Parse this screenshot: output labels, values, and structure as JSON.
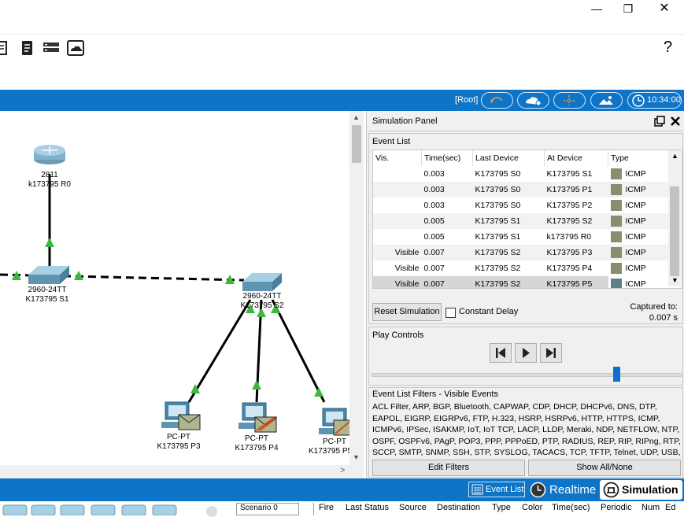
{
  "window": {
    "minimize": "—",
    "restore": "❐",
    "close": "✕"
  },
  "toolbar": {
    "help_label": "?"
  },
  "bluebar": {
    "root_label": "[Root]",
    "clock": "10:34:00"
  },
  "workspace": {
    "devices": [
      {
        "model": "2811",
        "name": "k173795 R0"
      },
      {
        "model": "2960-24TT",
        "name": "K173795 S1"
      },
      {
        "model": "2960-24TT",
        "name": "K173795 S2"
      },
      {
        "model": "PC-PT",
        "name": "K173795 P3"
      },
      {
        "model": "PC-PT",
        "name": "K173795 P4"
      },
      {
        "model": "PC-PT",
        "name": "K173795 P5"
      }
    ]
  },
  "simulation_panel": {
    "title": "Simulation Panel",
    "event_list_label": "Event List",
    "columns": [
      "Vis.",
      "Time(sec)",
      "Last Device",
      "At Device",
      "Type"
    ],
    "events": [
      {
        "vis": "",
        "time": "0.003",
        "last": "K173795 S0",
        "at": "K173795 S1",
        "type": "ICMP",
        "color": "#8c8c6e"
      },
      {
        "vis": "",
        "time": "0.003",
        "last": "K173795 S0",
        "at": "K173795 P1",
        "type": "ICMP",
        "color": "#8c8c6e"
      },
      {
        "vis": "",
        "time": "0.003",
        "last": "K173795 S0",
        "at": "K173795 P2",
        "type": "ICMP",
        "color": "#8c8c6e"
      },
      {
        "vis": "",
        "time": "0.005",
        "last": "K173795 S1",
        "at": "K173795 S2",
        "type": "ICMP",
        "color": "#8c8c6e"
      },
      {
        "vis": "",
        "time": "0.005",
        "last": "K173795 S1",
        "at": "k173795 R0",
        "type": "ICMP",
        "color": "#8c8c6e"
      },
      {
        "vis": "Visible",
        "time": "0.007",
        "last": "K173795 S2",
        "at": "K173795 P3",
        "type": "ICMP",
        "color": "#8c8c6e"
      },
      {
        "vis": "Visible",
        "time": "0.007",
        "last": "K173795 S2",
        "at": "K173795 P4",
        "type": "ICMP",
        "color": "#8c8c6e"
      },
      {
        "vis": "Visible",
        "time": "0.007",
        "last": "K173795 S2",
        "at": "K173795 P5",
        "type": "ICMP",
        "color": "#5f7f86"
      }
    ],
    "reset_button": "Reset Simulation",
    "constant_delay": "Constant Delay",
    "captured_label": "Captured to:",
    "captured_value": "0.007 s",
    "play_controls_label": "Play Controls",
    "filters_title": "Event List Filters - Visible Events",
    "filters_text": "ACL Filter, ARP, BGP, Bluetooth, CAPWAP, CDP, DHCP, DHCPv6, DNS, DTP, EAPOL, EIGRP, EIGRPv6, FTP, H.323, HSRP, HSRPv6, HTTP, HTTPS, ICMP, ICMPv6, IPSec, ISAKMP, IoT, IoT TCP, LACP, LLDP, Meraki, NDP, NETFLOW, NTP, OSPF, OSPFv6, PAgP, POP3, PPP, PPPoED, PTP, RADIUS, REP, RIP, RIPng, RTP, SCCP, SMTP, SNMP, SSH, STP, SYSLOG, TACACS, TCP, TFTP, Telnet, UDP, USB, VTP",
    "edit_filters": "Edit Filters",
    "show_all": "Show All/None"
  },
  "bottombar": {
    "event_list": "Event List",
    "realtime": "Realtime",
    "simulation": "Simulation"
  },
  "bottomstrip": {
    "scenario": "Scenario 0",
    "columns": [
      "Fire",
      "Last Status",
      "Source",
      "Destination",
      "Type",
      "Color",
      "Time(sec)",
      "Periodic",
      "Num",
      "Ed"
    ]
  }
}
